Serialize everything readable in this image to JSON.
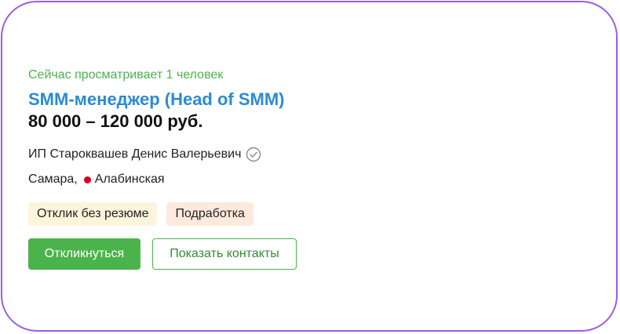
{
  "vacancy": {
    "viewers_text": "Сейчас просматривает 1 человек",
    "title": "SMM-менеджер (Head of SMM)",
    "salary": "80 000 – 120 000 руб.",
    "employer": "ИП Староквашев Денис Валерьевич",
    "employer_verified_icon": "check-circle-icon",
    "location": {
      "city": "Самара,",
      "metro_station": "Алабинская",
      "metro_color": "#d6001c"
    },
    "tags": [
      {
        "label": "Отклик без резюме",
        "color": "#fcf5dc"
      },
      {
        "label": "Подработка",
        "color": "#fde9dd"
      }
    ],
    "actions": {
      "respond_label": "Откликнуться",
      "contacts_label": "Показать контакты"
    }
  },
  "colors": {
    "accent_green": "#4bb34b",
    "link_blue": "#2b8ad8",
    "card_border": "#9b5de5"
  }
}
